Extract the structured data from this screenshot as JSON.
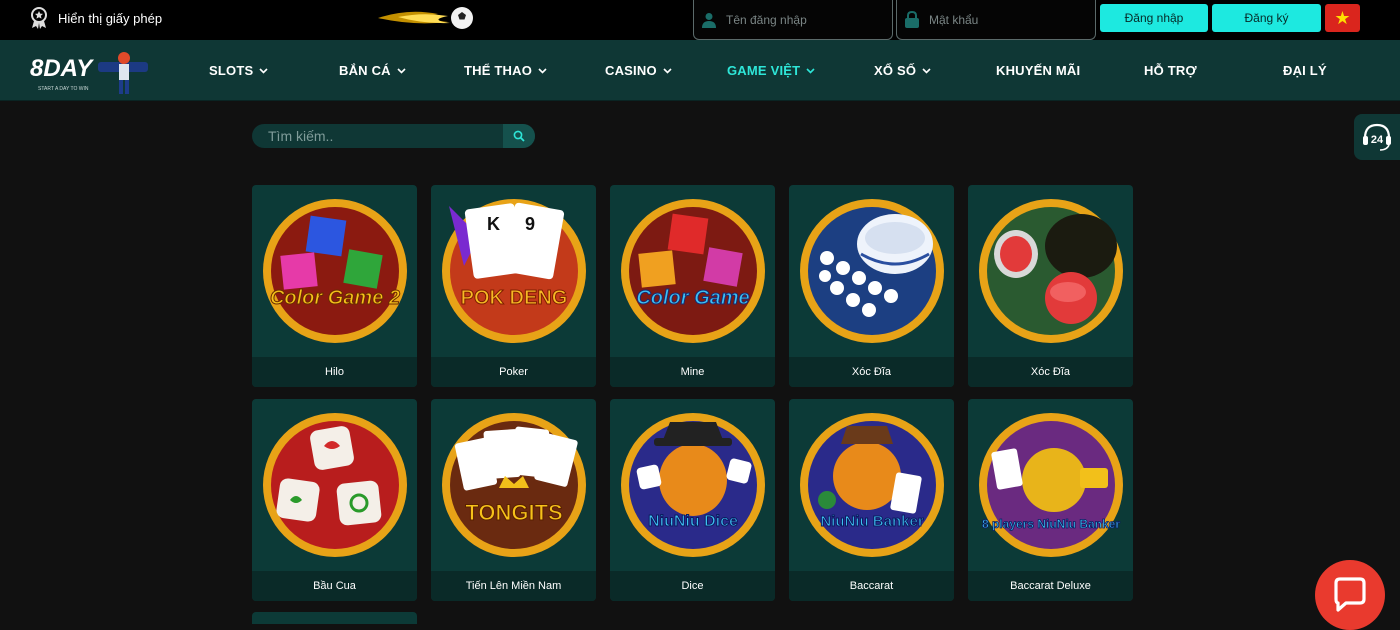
{
  "topbar": {
    "license_text": "Hiển thị giấy phép",
    "username_placeholder": "Tên đăng nhập",
    "password_placeholder": "Mật khẩu",
    "login_label": "Đăng nhập",
    "register_label": "Đăng ký"
  },
  "nav": {
    "items": [
      {
        "label": "SLOTS"
      },
      {
        "label": "BẮN CÁ"
      },
      {
        "label": "THỂ THAO"
      },
      {
        "label": "CASINO"
      },
      {
        "label": "GAME VIỆT"
      },
      {
        "label": "XỔ SỐ"
      },
      {
        "label": "KHUYẾN MÃI"
      },
      {
        "label": "HỖ TRỢ"
      },
      {
        "label": "ĐẠI LÝ"
      }
    ]
  },
  "brand": {
    "logo_text": "8DAY",
    "slogan": "START A DAY TO WIN"
  },
  "search": {
    "placeholder": "Tìm kiếm.."
  },
  "support": {
    "badge": "24"
  },
  "games": [
    {
      "label": "Hilo",
      "art": "Color Game 2"
    },
    {
      "label": "Poker",
      "art": "POK DENG"
    },
    {
      "label": "Mine",
      "art": "Color Game"
    },
    {
      "label": "Xóc Đĩa",
      "art": ""
    },
    {
      "label": "Xóc Đĩa",
      "art": ""
    },
    {
      "label": "Bầu Cua",
      "art": ""
    },
    {
      "label": "Tiến Lên Miền Nam",
      "art": "TONGITS"
    },
    {
      "label": "Dice",
      "art": "NiuNiu Dice"
    },
    {
      "label": "Baccarat",
      "art": "NiuNiu Banker"
    },
    {
      "label": "Baccarat Deluxe",
      "art": "8 players NiuNiu Banker"
    }
  ],
  "colors": {
    "accent": "#1de9e0",
    "nav_bg": "#0f3735",
    "card_bg": "#0c3a37",
    "chat": "#e93a2e"
  }
}
